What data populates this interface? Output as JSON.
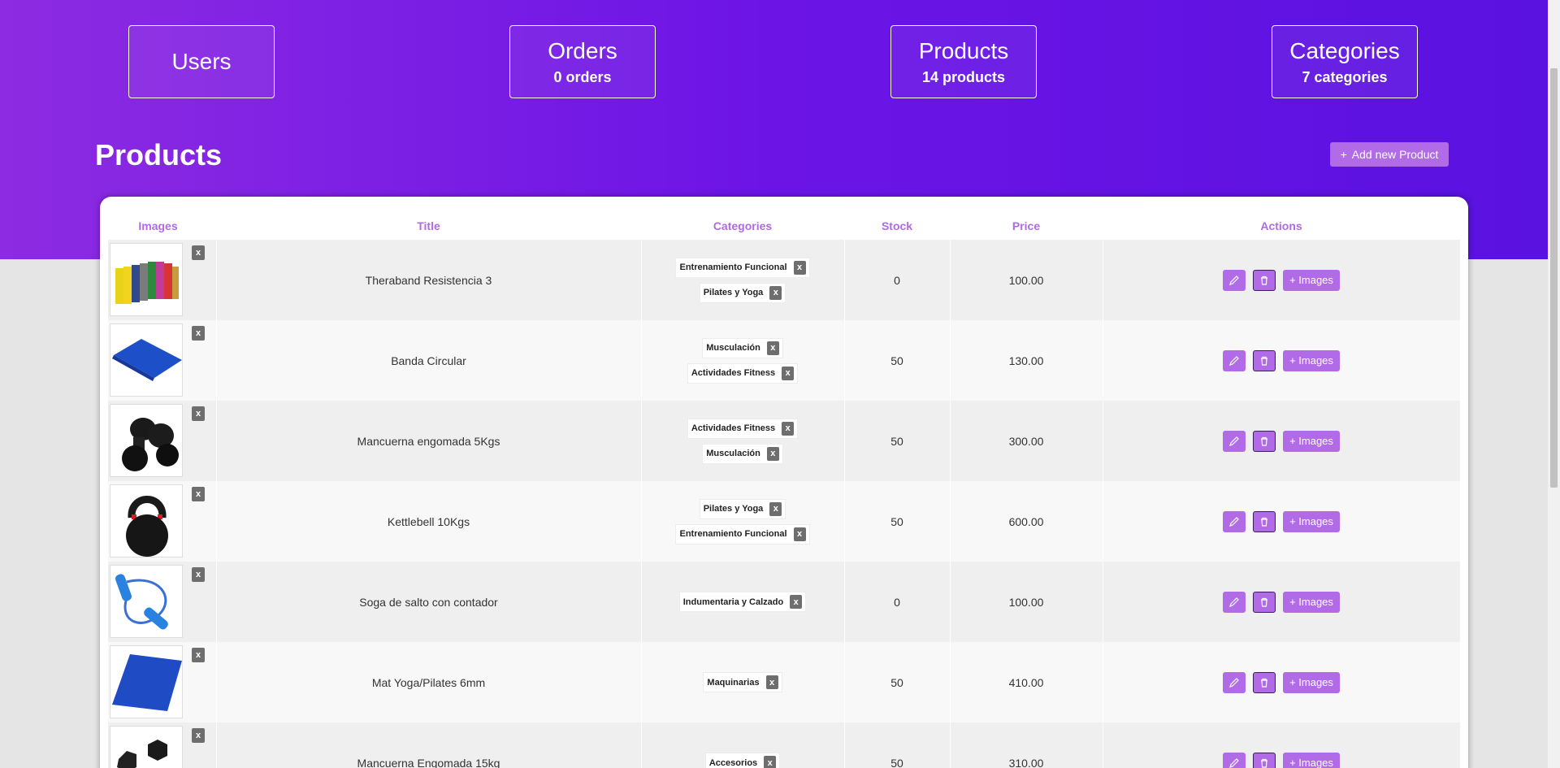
{
  "stats": [
    {
      "title": "Users",
      "sub": ""
    },
    {
      "title": "Orders",
      "sub": "0 orders"
    },
    {
      "title": "Products",
      "sub": "14 products"
    },
    {
      "title": "Categories",
      "sub": "7 categories"
    }
  ],
  "page_title": "Products",
  "add_button": {
    "icon": "+",
    "label": "Add new Product"
  },
  "table": {
    "headers": [
      "Images",
      "Title",
      "Categories",
      "Stock",
      "Price",
      "Actions"
    ],
    "remove_label": "x",
    "images_button": "+ Images",
    "rows": [
      {
        "image": "resistance-bands",
        "title": "Theraband Resistencia 3",
        "categories": [
          "Entrenamiento Funcional",
          "Pilates y Yoga"
        ],
        "stock": "0",
        "price": "100.00"
      },
      {
        "image": "circular-band",
        "title": "Banda Circular",
        "categories": [
          "Musculación",
          "Actividades Fitness"
        ],
        "stock": "50",
        "price": "130.00"
      },
      {
        "image": "dumbbells",
        "title": "Mancuerna engomada 5Kgs",
        "categories": [
          "Actividades Fitness",
          "Musculación"
        ],
        "stock": "50",
        "price": "300.00"
      },
      {
        "image": "kettlebell",
        "title": "Kettlebell 10Kgs",
        "categories": [
          "Pilates y Yoga",
          "Entrenamiento Funcional"
        ],
        "stock": "50",
        "price": "600.00"
      },
      {
        "image": "jump-rope",
        "title": "Soga de salto con contador",
        "categories": [
          "Indumentaria y Calzado"
        ],
        "stock": "0",
        "price": "100.00"
      },
      {
        "image": "yoga-mat",
        "title": "Mat Yoga/Pilates 6mm",
        "categories": [
          "Maquinarias"
        ],
        "stock": "50",
        "price": "410.00"
      },
      {
        "image": "hex-dumbbells",
        "title": "Mancuerna Engomada 15kg",
        "categories": [
          "Accesorios"
        ],
        "stock": "50",
        "price": "310.00"
      }
    ]
  },
  "colors": {
    "accent": "#b26be6",
    "hero_start": "#8d2be2",
    "hero_end": "#5a12e0"
  }
}
